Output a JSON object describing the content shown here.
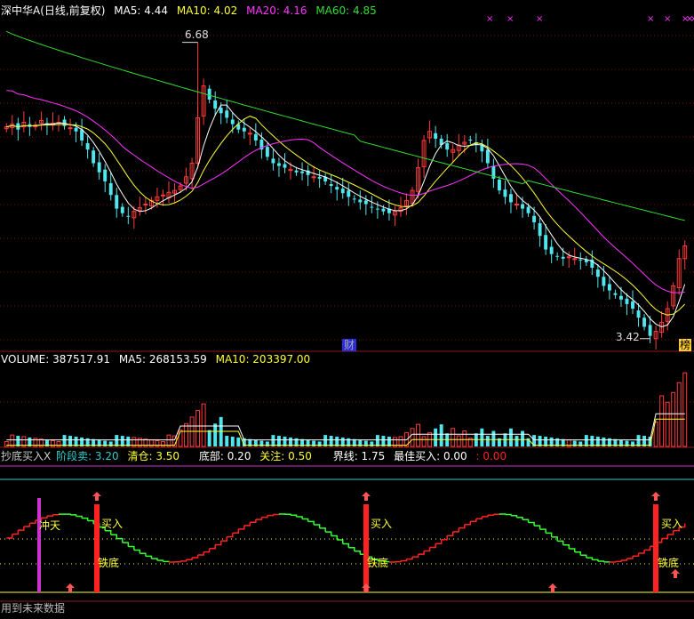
{
  "colors": {
    "up": "#ff3b3b",
    "down": "#4fe6ee",
    "ma5": "#ffffff",
    "ma10": "#ffff33",
    "ma20": "#ff33ff",
    "ma60": "#33dd33",
    "grid": "#7a1010",
    "divider": "#8b1a1a",
    "sub_cyan": "#33cccc",
    "sub_yellow": "#ffff33",
    "sub_magenta": "#cc33cc",
    "sub_green": "#33ff33",
    "sub_red": "#ff2222"
  },
  "header": {
    "title": "深中华A(日线,前复权)",
    "ma5_label": "MA5: 4.44",
    "ma10_label": "MA10: 4.02",
    "ma20_label": "MA20: 4.16",
    "ma60_label": "MA60: 4.85"
  },
  "annotations": {
    "high": "6.68",
    "low": "3.42",
    "cai": "财",
    "bang": "榜"
  },
  "volume_header": {
    "volume": "VOLUME: 387517.91",
    "ma5": "MA5: 268153.59",
    "ma10": "MA10: 203397.00"
  },
  "indicator_header": {
    "name": "抄底买入X",
    "stage_sell": "阶段卖: 3.20",
    "clear": "清仓: 3.50",
    "bottom": "底部: 0.20",
    "focus": "关注: 0.50",
    "boundary": "界线: 1.75",
    "best_buy": "最佳买入: 0.00",
    "neg": ": 0.00"
  },
  "signals": {
    "chongtian": "冲天",
    "buy": "买入",
    "tiedi": "铁底"
  },
  "footer_text": "用到未来数据",
  "chart_data": {
    "type": "candlestick",
    "price_range": [
      3.3,
      6.95
    ],
    "high": 6.68,
    "low": 3.42,
    "closes": [
      5.75,
      5.78,
      5.72,
      5.8,
      5.75,
      5.77,
      5.82,
      5.78,
      5.79,
      5.8,
      5.76,
      5.74,
      5.7,
      5.6,
      5.5,
      5.35,
      5.25,
      5.15,
      5.0,
      4.85,
      4.8,
      4.76,
      4.82,
      4.86,
      4.9,
      4.94,
      4.98,
      5.0,
      5.03,
      5.05,
      5.1,
      5.2,
      5.35,
      5.85,
      6.2,
      6.05,
      5.95,
      5.9,
      5.85,
      5.78,
      5.72,
      5.7,
      5.68,
      5.6,
      5.5,
      5.42,
      5.35,
      5.32,
      5.3,
      5.28,
      5.25,
      5.24,
      5.22,
      5.2,
      5.18,
      5.15,
      5.1,
      5.06,
      5.02,
      4.98,
      4.95,
      4.92,
      4.9,
      4.86,
      4.84,
      4.82,
      4.8,
      4.82,
      4.86,
      4.94,
      5.05,
      5.3,
      5.6,
      5.7,
      5.62,
      5.55,
      5.5,
      5.5,
      5.55,
      5.58,
      5.6,
      5.55,
      5.48,
      5.35,
      5.18,
      5.05,
      4.98,
      4.92,
      4.9,
      4.85,
      4.8,
      4.7,
      4.55,
      4.4,
      4.35,
      4.32,
      4.3,
      4.32,
      4.3,
      4.28,
      4.26,
      4.2,
      4.1,
      4.0,
      3.95,
      3.9,
      3.85,
      3.8,
      3.75,
      3.65,
      3.55,
      3.45,
      3.5,
      3.6,
      3.75,
      4.0,
      4.3,
      4.44
    ],
    "ma5_line": "MA5",
    "ma10_line": "MA10",
    "ma20_line": "MA20",
    "ma60_line": "MA60",
    "ma60_start": 6.8,
    "ma60_end": 4.72,
    "volume": {
      "current": 387517.91,
      "ma5": 268153.59,
      "ma10": 203397.0
    },
    "indicator": {
      "stage_sell": 3.2,
      "clear": 3.5,
      "bottom": 0.2,
      "focus": 0.5,
      "boundary": 1.75,
      "best_buy": 0.0
    }
  }
}
